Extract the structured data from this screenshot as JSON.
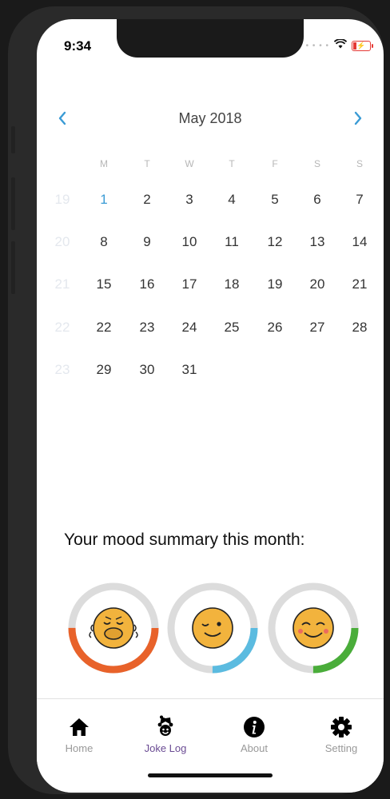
{
  "status_bar": {
    "time": "9:34"
  },
  "calendar": {
    "month_title": "May 2018",
    "weekdays": [
      "M",
      "T",
      "W",
      "T",
      "F",
      "S",
      "S"
    ],
    "weeks": [
      {
        "number": "19",
        "days": [
          "1",
          "2",
          "3",
          "4",
          "5",
          "6",
          "7"
        ]
      },
      {
        "number": "20",
        "days": [
          "8",
          "9",
          "10",
          "11",
          "12",
          "13",
          "14"
        ]
      },
      {
        "number": "21",
        "days": [
          "15",
          "16",
          "17",
          "18",
          "19",
          "20",
          "21"
        ]
      },
      {
        "number": "22",
        "days": [
          "22",
          "23",
          "24",
          "25",
          "26",
          "27",
          "28"
        ]
      },
      {
        "number": "23",
        "days": [
          "29",
          "30",
          "31"
        ]
      }
    ],
    "today": "1",
    "accent_color": "#3a9bd5"
  },
  "summary": {
    "title": "Your mood summary this month:",
    "moods": [
      {
        "icon": "sick-face-icon",
        "color": "#e8622a",
        "fraction": 0.5
      },
      {
        "icon": "winking-face-icon",
        "color": "#5bbbe0",
        "fraction": 0.25
      },
      {
        "icon": "smiling-face-icon",
        "color": "#4aad3a",
        "fraction": 0.25
      }
    ]
  },
  "tabbar": {
    "tabs": [
      {
        "label": "Home",
        "icon": "home-icon",
        "active": false
      },
      {
        "label": "Joke Log",
        "icon": "jester-icon",
        "active": true
      },
      {
        "label": "About",
        "icon": "info-icon",
        "active": false
      },
      {
        "label": "Setting",
        "icon": "gear-icon",
        "active": false
      }
    ],
    "active_color": "#6a4b93"
  }
}
